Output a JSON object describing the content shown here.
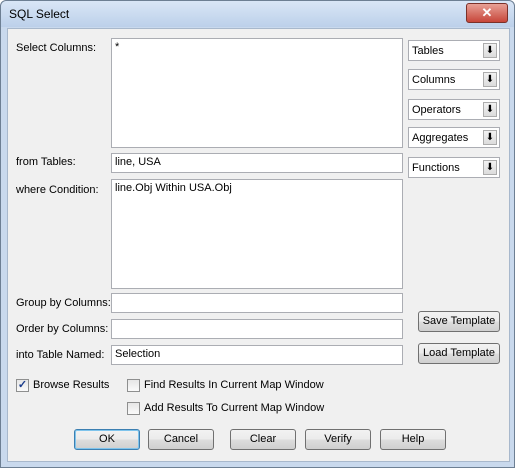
{
  "window": {
    "title": "SQL Select",
    "close_label": "✕"
  },
  "labels": {
    "select_columns": "Select Columns:",
    "from_tables": "from Tables:",
    "where_condition": "where Condition:",
    "group_by": "Group by Columns:",
    "order_by": "Order by Columns:",
    "into_table": "into Table Named:"
  },
  "fields": {
    "select_columns": "*",
    "from_tables": "line, USA",
    "where_condition": "line.Obj Within USA.Obj",
    "group_by": "",
    "order_by": "",
    "into_table": "Selection"
  },
  "dropdowns": [
    "Tables",
    "Columns",
    "Operators",
    "Aggregates",
    "Functions"
  ],
  "dropdown_arrow": "⬇",
  "side_buttons": {
    "save_template": "Save Template",
    "load_template": "Load Template"
  },
  "checkboxes": {
    "browse_results": {
      "label": "Browse Results",
      "checked": true
    },
    "find_results": {
      "label": "Find Results In Current Map Window",
      "checked": false
    },
    "add_results": {
      "label": "Add Results To Current Map Window",
      "checked": false
    }
  },
  "check_mark": "✓",
  "bottom_buttons": {
    "ok": "OK",
    "cancel": "Cancel",
    "clear": "Clear",
    "verify": "Verify",
    "help": "Help"
  }
}
